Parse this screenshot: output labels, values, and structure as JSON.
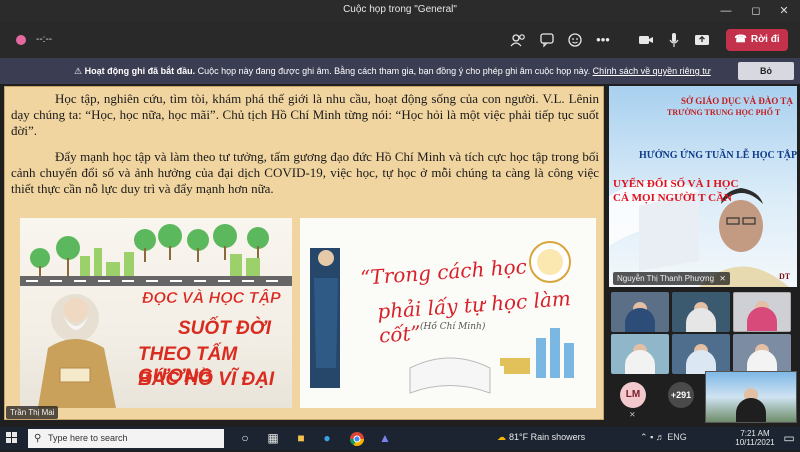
{
  "window": {
    "title": "Cuộc họp trong \"General\"",
    "minimize_icon": "minimize-icon",
    "maximize_icon": "maximize-icon",
    "close_icon": "close-icon"
  },
  "toolbar": {
    "timer": "--:--",
    "leave_label": "Rời đi",
    "icons": [
      "record-dot-icon",
      "people-icon",
      "chat-icon",
      "reactions-icon",
      "more-icon",
      "camera-icon",
      "mic-icon",
      "share-icon",
      "phone-icon"
    ]
  },
  "banner": {
    "bold_text": "Hoạt động ghi đã bắt đầu.",
    "text": " Cuộc họp này đang được ghi âm. Bằng cách tham gia, bạn đồng ý cho phép ghi âm cuộc họp này. ",
    "link_text": "Chính sách về quyền riêng tư",
    "dismiss_label": "Bỏ",
    "accent_color": "#3b3d52"
  },
  "slide": {
    "paragraph_1": "Học tập, nghiên cứu, tìm tòi, khám phá thế giới là nhu cầu, hoạt động sống của con người. V.L. Lênin dạy chúng ta: “Học, học nữa, học mãi”. Chủ tịch Hồ Chí Minh từng nói: “Học hỏi là một việc phải tiếp tục suốt đời”.",
    "paragraph_2": "Đẩy mạnh học tập và làm theo tư tưởng, tấm gương đạo đức Hồ Chí Minh và tích cực học tập trong bối cảnh chuyển đổi số và ảnh hưởng của đại dịch COVID-19, việc học, tự học ở mỗi chúng ta càng là công việc thiết thực cần nỗ lực duy trì và đẩy mạnh hơn nữa.",
    "poster_left": {
      "line_1": "ĐỌC VÀ HỌC TẬP",
      "line_2": "SUỐT ĐỜI",
      "line_3": "THEO TẤM GƯƠNG",
      "line_4": "BÁC HỒ VĨ ĐẠI"
    },
    "poster_right": {
      "line_1": "“Trong cách học",
      "line_2": "phải lấy tự học làm cốt”",
      "attribution": "(Hồ Chí Minh)"
    },
    "presenter_name": "Trần Thị Mai",
    "background_color": "#f1d5a0"
  },
  "participants": {
    "main_name": "Nguyễn Thị Thanh Phượng",
    "main_background": {
      "line_1": "SỞ GIÁO DỤC VÀ ĐÀO TẠ",
      "line_2": "TRƯỜNG TRUNG HỌC PHỔ T",
      "line_3": "HƯỞNG ỨNG TUẦN LỄ HỌC TẬP",
      "line_4": "UYỂN ĐỔI SỐ VÀ   I HỌC",
      "line_5": "CẢ MỌI NGƯỜI T   CẦN",
      "corner": "DT"
    },
    "initials": "LM",
    "overflow_count": "+291"
  },
  "taskbar": {
    "search_placeholder": "Type here to search",
    "weather": "81°F  Rain showers",
    "language": "ENG",
    "time": "7:21 AM",
    "date": "10/11/2021"
  }
}
